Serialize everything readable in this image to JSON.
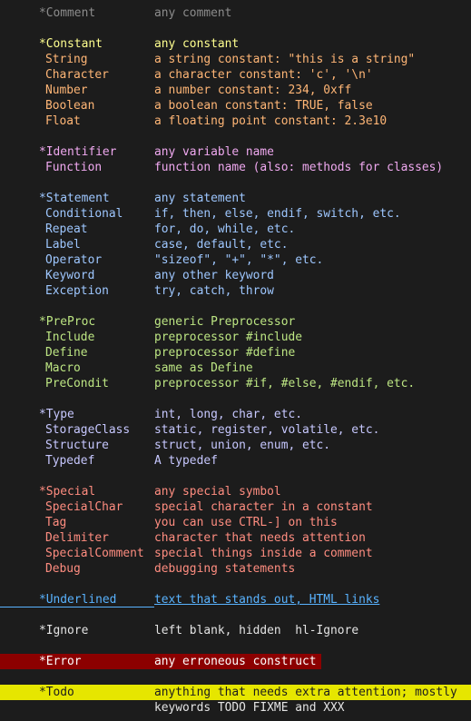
{
  "comment": {
    "group": "*Comment",
    "desc": "any comment"
  },
  "constant": {
    "group": "*Constant",
    "desc": "any constant",
    "items": [
      {
        "name": "String",
        "desc": "a string constant: \"this is a string\""
      },
      {
        "name": "Character",
        "desc": "a character constant: 'c', '\\n'"
      },
      {
        "name": "Number",
        "desc": "a number constant: 234, 0xff"
      },
      {
        "name": "Boolean",
        "desc": "a boolean constant: TRUE, false"
      },
      {
        "name": "Float",
        "desc": "a floating point constant: 2.3e10"
      }
    ]
  },
  "identifier": {
    "group": "*Identifier",
    "desc": "any variable name",
    "items": [
      {
        "name": "Function",
        "desc": "function name (also: methods for classes)"
      }
    ]
  },
  "statement": {
    "group": "*Statement",
    "desc": "any statement",
    "items": [
      {
        "name": "Conditional",
        "desc": "if, then, else, endif, switch, etc."
      },
      {
        "name": "Repeat",
        "desc": "for, do, while, etc."
      },
      {
        "name": "Label",
        "desc": "case, default, etc."
      },
      {
        "name": "Operator",
        "desc": "\"sizeof\", \"+\", \"*\", etc."
      },
      {
        "name": "Keyword",
        "desc": "any other keyword"
      },
      {
        "name": "Exception",
        "desc": "try, catch, throw"
      }
    ]
  },
  "preproc": {
    "group": "*PreProc",
    "desc": "generic Preprocessor",
    "items": [
      {
        "name": "Include",
        "desc": "preprocessor #include"
      },
      {
        "name": "Define",
        "desc": "preprocessor #define"
      },
      {
        "name": "Macro",
        "desc": "same as Define"
      },
      {
        "name": "PreCondit",
        "desc": "preprocessor #if, #else, #endif, etc."
      }
    ]
  },
  "type": {
    "group": "*Type",
    "desc": "int, long, char, etc.",
    "items": [
      {
        "name": "StorageClass",
        "desc": "static, register, volatile, etc."
      },
      {
        "name": "Structure",
        "desc": "struct, union, enum, etc."
      },
      {
        "name": "Typedef",
        "desc": "A typedef"
      }
    ]
  },
  "special": {
    "group": "*Special",
    "desc": "any special symbol",
    "items": [
      {
        "name": "SpecialChar",
        "desc": "special character in a constant"
      },
      {
        "name": "Tag",
        "desc": "you can use CTRL-] on this"
      },
      {
        "name": "Delimiter",
        "desc": "character that needs attention"
      },
      {
        "name": "SpecialComment",
        "desc": "special things inside a comment"
      },
      {
        "name": "Debug",
        "desc": "debugging statements"
      }
    ]
  },
  "underlined": {
    "group": "*Underlined",
    "desc": "text that stands out, HTML links"
  },
  "ignore": {
    "group": "*Ignore",
    "desc": "left blank, hidden",
    "hl": "hl-Ignore"
  },
  "error": {
    "group": "*Error",
    "desc": "any erroneous construct"
  },
  "todo": {
    "group": "*Todo",
    "desc": "anything that needs extra attention; mostly",
    "desc2": "keywords TODO FIXME and XXX"
  },
  "colors": {
    "background": "#1c1c1c",
    "comment": "#8c8c8c",
    "constant": "#ffff8f",
    "constant_sub": "#ffb676",
    "identifier": "#f0a9f0",
    "statement": "#9ec7ff",
    "preproc": "#bde683",
    "type": "#c7c8ff",
    "special": "#ff8d80",
    "underlined": "#59b3ff",
    "error_bg": "#8c0000",
    "todo_bg": "#e6e600"
  }
}
